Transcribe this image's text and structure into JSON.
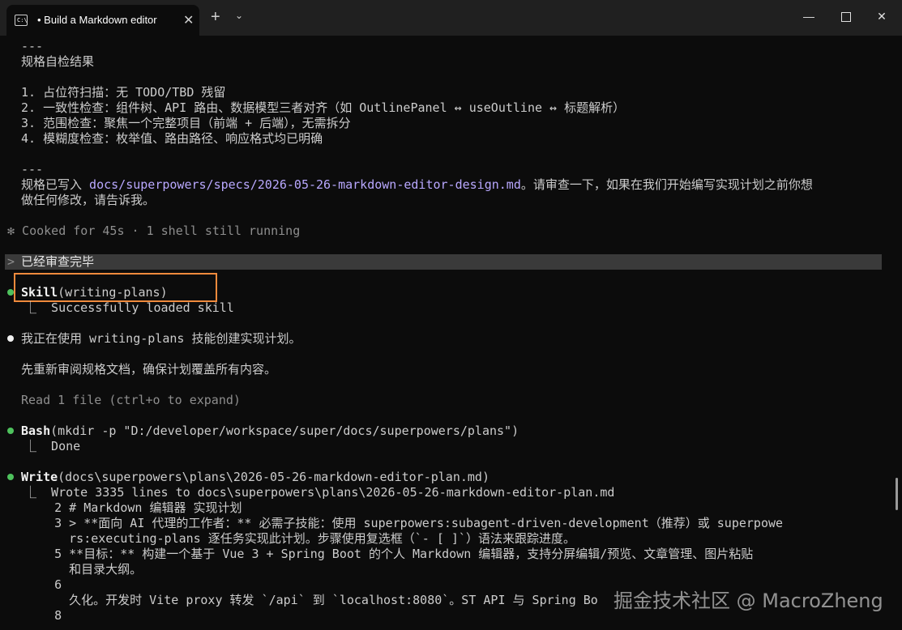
{
  "window": {
    "tab_title": "• Build a Markdown editor",
    "tab_icon_text": "C:\\",
    "close_tab": "✕",
    "new_tab": "+",
    "dropdown": "⌄",
    "minimize": "—",
    "close_window": "✕"
  },
  "terminal": {
    "l1": "---",
    "l2": "规格自检结果",
    "l3": "1. 占位符扫描：无 TODO/TBD 残留",
    "l4": "2. 一致性检查：组件树、API 路由、数据模型三者对齐（如 OutlinePanel ↔ useOutline ↔ 标题解析）",
    "l5": "3. 范围检查：聚焦一个完整项目（前端 + 后端），无需拆分",
    "l6": "4. 模糊度检查：枚举值、路由路径、响应格式均已明确",
    "l7": "---",
    "l8_pre": "规格已写入 ",
    "l8_path": "docs/superpowers/specs/2026-05-26-markdown-editor-design.md",
    "l8_post": "。请审查一下，如果在我们开始编写实现计划之前你想",
    "l9": "做任何修改，请告诉我。",
    "l10": "✻ Cooked for 45s · 1 shell still running",
    "l11_marker": ">",
    "l11": "已经审查完毕",
    "l12_tool": "Skill",
    "l12_args": "(writing-plans)",
    "l13": "⎿  Successfully loaded skill",
    "l14": "我正在使用 writing-plans 技能创建实现计划。",
    "l15": "先重新审阅规格文档，确保计划覆盖所有内容。",
    "l16": "Read 1 file (ctrl+o to expand)",
    "l17_tool": "Bash",
    "l17_args": "(mkdir -p \"D:/developer/workspace/super/docs/superpowers/plans\")",
    "l18": "⎿  Done",
    "l19_tool": "Write",
    "l19_args": "(docs\\superpowers\\plans\\2026-05-26-markdown-editor-plan.md)",
    "l20": "⎿  Wrote 3335 lines to docs\\superpowers\\plans\\2026-05-26-markdown-editor-plan.md",
    "l21": "   2 # Markdown 编辑器 实现计划",
    "l22": "   3 > **面向 AI 代理的工作者：** 必需子技能：使用 superpowers:subagent-driven-development（推荐）或 superpowe",
    "l23": "     rs:executing-plans 逐任务实现此计划。步骤使用复选框（`- [ ]`）语法来跟踪进度。",
    "l24": "   5 **目标：** 构建一个基于 Vue 3 + Spring Boot 的个人 Markdown 编辑器，支持分屏编辑/预览、文章管理、图片粘贴",
    "l25": "     和目录大纲。",
    "l26": "   6",
    "l27": "     久化。开发时 Vite proxy 转发 `/api` 到 `localhost:8080`。ST API 与 Spring Bo",
    "l28": "   8"
  },
  "watermark": "掘金技术社区 @ MacroZheng"
}
